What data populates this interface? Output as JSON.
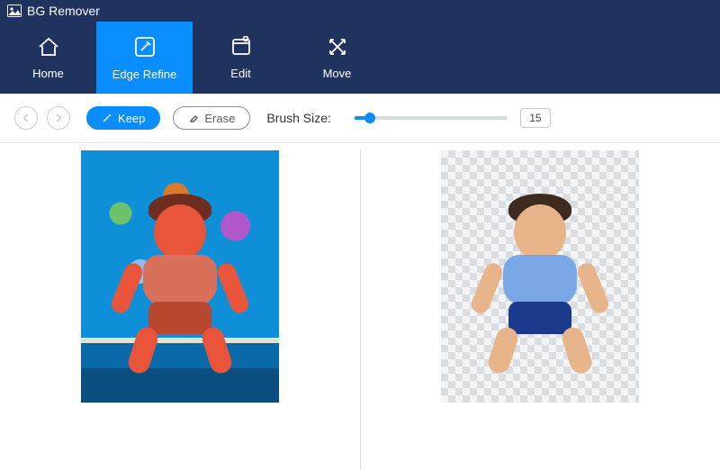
{
  "app": {
    "title": "BG Remover"
  },
  "tabs": [
    {
      "label": "Home",
      "active": false
    },
    {
      "label": "Edge Refine",
      "active": true
    },
    {
      "label": "Edit",
      "active": false
    },
    {
      "label": "Move",
      "active": false
    }
  ],
  "toolbar": {
    "keep_label": "Keep",
    "erase_label": "Erase",
    "brush_label": "Brush Size:",
    "brush_value": "15"
  }
}
